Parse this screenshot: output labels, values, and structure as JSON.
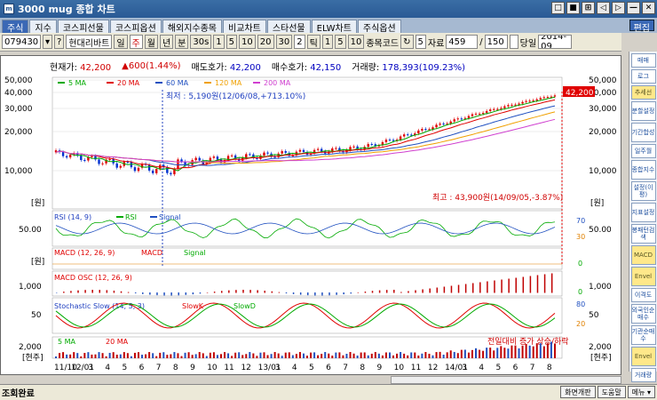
{
  "window": {
    "title": "3000 mug 종합 차트",
    "icon": "mug-icon",
    "buttons": [
      "□",
      "■",
      "⊞",
      "◁",
      "▷",
      "—",
      "✕"
    ]
  },
  "tabs": [
    "주식",
    "지수",
    "코스피선물",
    "코스피옵션",
    "해외지수종목",
    "비교차트",
    "스타선물",
    "ELW차트",
    "주식옵션"
  ],
  "edit_label": "편집",
  "toolbar": {
    "code": "079430",
    "name": "현대리바트",
    "period_buttons": [
      "일",
      "주",
      "월",
      "년",
      "분",
      "30s",
      "1",
      "5",
      "10",
      "20",
      "30"
    ],
    "tick_buttons": [
      "2",
      "틱",
      "1",
      "5",
      "10"
    ],
    "code_label": "종목코드",
    "count_value": "5",
    "data_label": "자료",
    "data_count": "459",
    "slash": "/",
    "total": "150",
    "today_label": "당일",
    "date": "2014-09"
  },
  "info": {
    "price_label": "현재가:",
    "price": "42,200",
    "change": "▲600(1.44%)",
    "ask_label": "매도호가:",
    "ask": "42,200",
    "bid_label": "매수호가:",
    "bid": "42,150",
    "vol_label": "거래량:",
    "vol": "178,393(109.23%)"
  },
  "legend_ma": [
    {
      "label": "5 MA",
      "color": "#00aa00"
    },
    {
      "label": "20 MA",
      "color": "#e00000"
    },
    {
      "label": "60 MA",
      "color": "#2050c0"
    },
    {
      "label": "120 MA",
      "color": "#f0a000"
    },
    {
      "label": "200 MA",
      "color": "#d040d0"
    }
  ],
  "annotations": {
    "low": "최저 : 5,190원(12/06/08,+713.10%)",
    "high": "최고 : 43,900원(14/09/05,-3.87%)",
    "current_tag": "42,200",
    "volume_note": "전일대비 증가 상승/하락"
  },
  "y_axis_main": [
    "50,000",
    "40,000",
    "30,000",
    "20,000",
    "10,000"
  ],
  "unit_won": "[원]",
  "unit_share": "[현주]",
  "rsi": {
    "title": "RSI (14, 9)",
    "rsi_label": "RSI",
    "signal_label": "Signal",
    "left": "50.00",
    "right": "50.00",
    "levels": [
      "70",
      "30"
    ]
  },
  "macd": {
    "title": "MACD (12, 26, 9)",
    "macd_label": "MACD",
    "signal_label": "Signal",
    "level": "0"
  },
  "macd_osc": {
    "title": "MACD OSC (12, 26, 9)",
    "left": "1,000",
    "right": "1,000",
    "level": "0"
  },
  "stoch": {
    "title": "Stochastic Slow (14, 5, 3)",
    "k_label": "SlowK",
    "d_label": "SlowD",
    "left": "50",
    "right": "50",
    "levels": [
      "80",
      "20"
    ]
  },
  "volume": {
    "ma5": "5 MA",
    "ma20": "20 MA",
    "left": "2,000",
    "right": "2,000"
  },
  "x_axis": [
    "11/10",
    "12/01",
    "3",
    "4",
    "5",
    "6",
    "7",
    "8",
    "9",
    "10",
    "11",
    "12",
    "13/01",
    "3",
    "4",
    "5",
    "6",
    "7",
    "8",
    "9",
    "10",
    "11",
    "12",
    "14/01",
    "3",
    "4",
    "5",
    "6",
    "7",
    "8"
  ],
  "sidebar": [
    "매매",
    "로그",
    "추세선",
    "분할설정",
    "기간합성",
    "일주월",
    "종합지수",
    "설정(이평)",
    "지표설정",
    "봉패턴검색",
    "MACD",
    "Envel",
    "이격도",
    "외국인순매수",
    "기관순매수",
    "Envel",
    "거래량"
  ],
  "status": {
    "text": "조회완료",
    "buttons": [
      "화면개판",
      "도움말",
      "메뉴 ▾"
    ]
  },
  "colors": {
    "up": "#e00000",
    "down": "#0030d0",
    "accent": "#3a68b5"
  }
}
